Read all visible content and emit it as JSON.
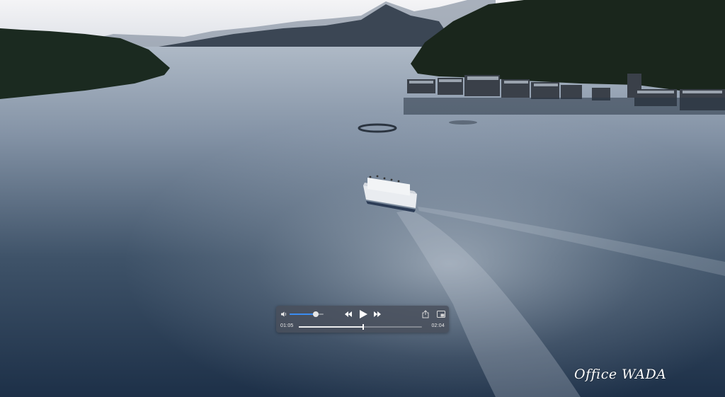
{
  "player": {
    "elapsed": "01:05",
    "total": "02:04",
    "progress": 0.524,
    "volume": 0.78
  },
  "icons": {
    "volume": "speaker-icon",
    "rewind": "rewind-icon",
    "play": "play-icon",
    "forward": "fast-forward-icon",
    "share": "share-icon",
    "pip": "picture-in-picture-icon"
  },
  "watermark": {
    "text": "Office WADA"
  },
  "colors": {
    "accent": "#3b8cf0",
    "control_bg": "#484e5a"
  }
}
